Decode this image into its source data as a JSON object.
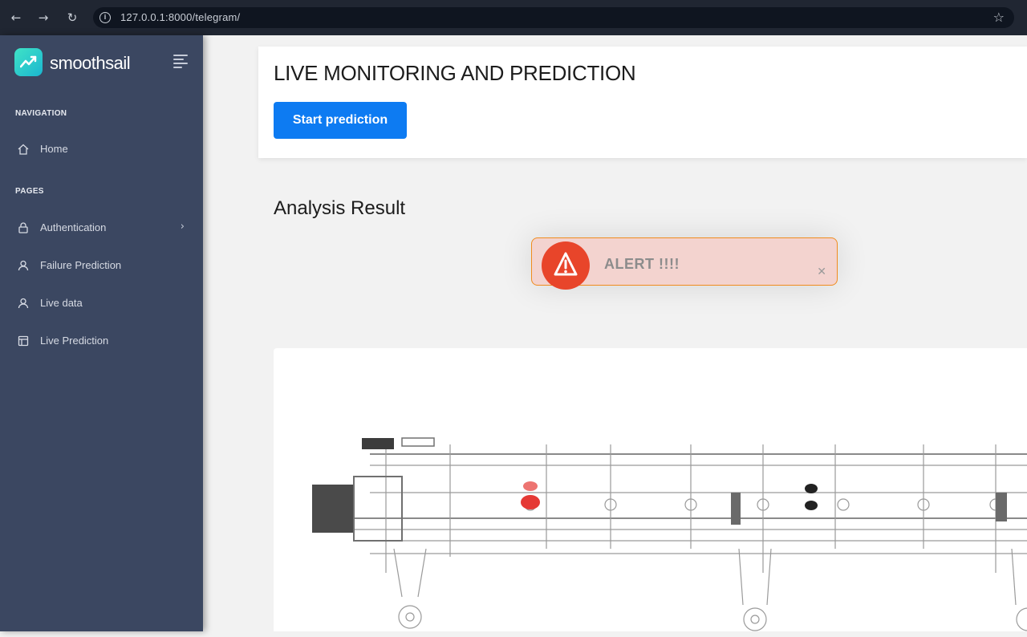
{
  "browser": {
    "url": "127.0.0.1:8000/telegram/"
  },
  "sidebar": {
    "brand": "smoothsail",
    "sections": [
      {
        "label": "NAVIGATION"
      },
      {
        "label": "PAGES"
      }
    ],
    "items": [
      {
        "label": "Home",
        "icon": "home-icon"
      },
      {
        "label": "Authentication",
        "icon": "lock-icon",
        "has_submenu": true
      },
      {
        "label": "Failure Prediction",
        "icon": "user-icon"
      },
      {
        "label": "Live data",
        "icon": "user-icon"
      },
      {
        "label": "Live Prediction",
        "icon": "layout-icon"
      }
    ]
  },
  "main": {
    "title": "LIVE MONITORING AND PREDICTION",
    "start_button": "Start prediction",
    "section_title": "Analysis Result",
    "alert": {
      "text": "ALERT !!!!",
      "color": "#e8452a",
      "border_color": "#f08c1e"
    }
  },
  "colors": {
    "sidebar": "#3b4761",
    "primary": "#0d7bf2",
    "brand_accent": "#3fe3c6"
  }
}
